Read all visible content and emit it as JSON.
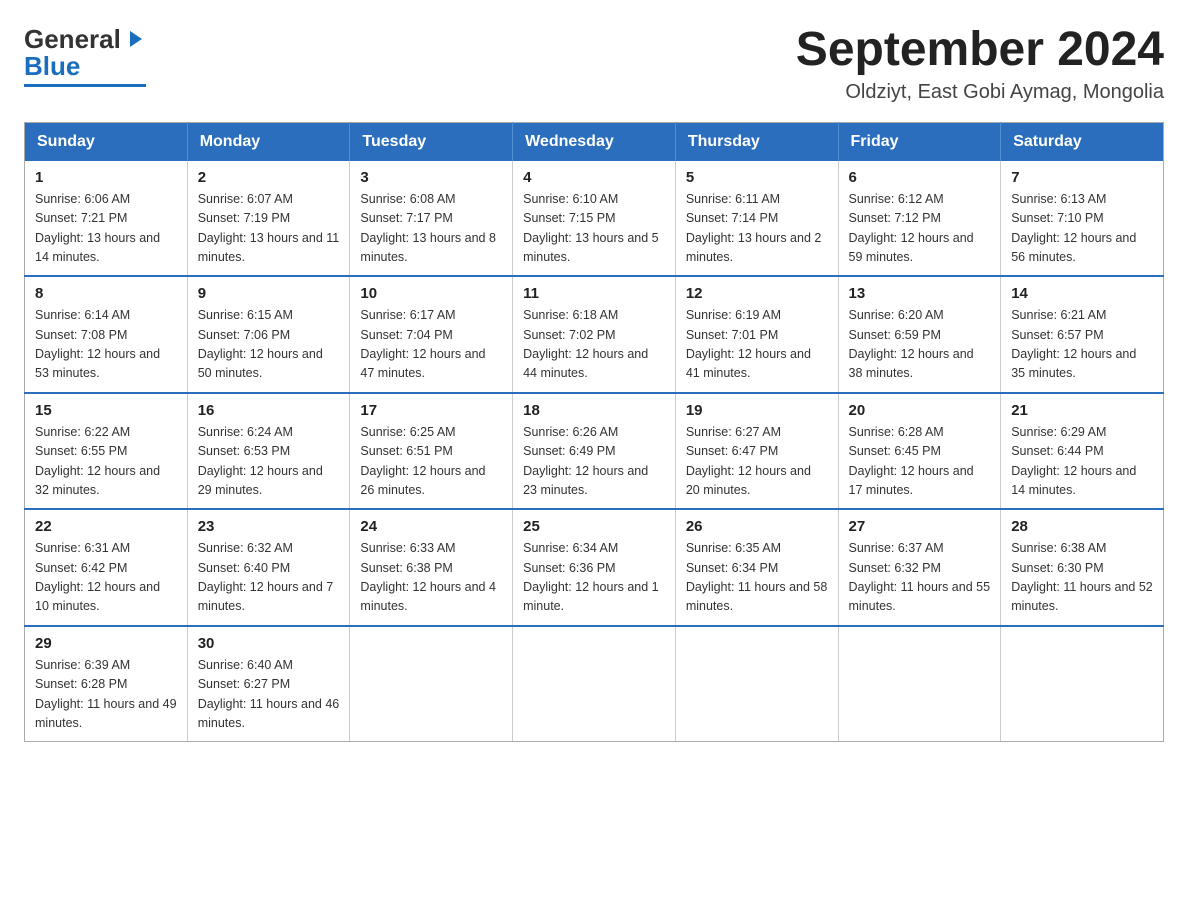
{
  "header": {
    "logo_general": "General",
    "logo_blue": "Blue",
    "main_title": "September 2024",
    "subtitle": "Oldziyt, East Gobi Aymag, Mongolia"
  },
  "calendar": {
    "days": [
      "Sunday",
      "Monday",
      "Tuesday",
      "Wednesday",
      "Thursday",
      "Friday",
      "Saturday"
    ],
    "weeks": [
      [
        {
          "num": "1",
          "sunrise": "Sunrise: 6:06 AM",
          "sunset": "Sunset: 7:21 PM",
          "daylight": "Daylight: 13 hours and 14 minutes."
        },
        {
          "num": "2",
          "sunrise": "Sunrise: 6:07 AM",
          "sunset": "Sunset: 7:19 PM",
          "daylight": "Daylight: 13 hours and 11 minutes."
        },
        {
          "num": "3",
          "sunrise": "Sunrise: 6:08 AM",
          "sunset": "Sunset: 7:17 PM",
          "daylight": "Daylight: 13 hours and 8 minutes."
        },
        {
          "num": "4",
          "sunrise": "Sunrise: 6:10 AM",
          "sunset": "Sunset: 7:15 PM",
          "daylight": "Daylight: 13 hours and 5 minutes."
        },
        {
          "num": "5",
          "sunrise": "Sunrise: 6:11 AM",
          "sunset": "Sunset: 7:14 PM",
          "daylight": "Daylight: 13 hours and 2 minutes."
        },
        {
          "num": "6",
          "sunrise": "Sunrise: 6:12 AM",
          "sunset": "Sunset: 7:12 PM",
          "daylight": "Daylight: 12 hours and 59 minutes."
        },
        {
          "num": "7",
          "sunrise": "Sunrise: 6:13 AM",
          "sunset": "Sunset: 7:10 PM",
          "daylight": "Daylight: 12 hours and 56 minutes."
        }
      ],
      [
        {
          "num": "8",
          "sunrise": "Sunrise: 6:14 AM",
          "sunset": "Sunset: 7:08 PM",
          "daylight": "Daylight: 12 hours and 53 minutes."
        },
        {
          "num": "9",
          "sunrise": "Sunrise: 6:15 AM",
          "sunset": "Sunset: 7:06 PM",
          "daylight": "Daylight: 12 hours and 50 minutes."
        },
        {
          "num": "10",
          "sunrise": "Sunrise: 6:17 AM",
          "sunset": "Sunset: 7:04 PM",
          "daylight": "Daylight: 12 hours and 47 minutes."
        },
        {
          "num": "11",
          "sunrise": "Sunrise: 6:18 AM",
          "sunset": "Sunset: 7:02 PM",
          "daylight": "Daylight: 12 hours and 44 minutes."
        },
        {
          "num": "12",
          "sunrise": "Sunrise: 6:19 AM",
          "sunset": "Sunset: 7:01 PM",
          "daylight": "Daylight: 12 hours and 41 minutes."
        },
        {
          "num": "13",
          "sunrise": "Sunrise: 6:20 AM",
          "sunset": "Sunset: 6:59 PM",
          "daylight": "Daylight: 12 hours and 38 minutes."
        },
        {
          "num": "14",
          "sunrise": "Sunrise: 6:21 AM",
          "sunset": "Sunset: 6:57 PM",
          "daylight": "Daylight: 12 hours and 35 minutes."
        }
      ],
      [
        {
          "num": "15",
          "sunrise": "Sunrise: 6:22 AM",
          "sunset": "Sunset: 6:55 PM",
          "daylight": "Daylight: 12 hours and 32 minutes."
        },
        {
          "num": "16",
          "sunrise": "Sunrise: 6:24 AM",
          "sunset": "Sunset: 6:53 PM",
          "daylight": "Daylight: 12 hours and 29 minutes."
        },
        {
          "num": "17",
          "sunrise": "Sunrise: 6:25 AM",
          "sunset": "Sunset: 6:51 PM",
          "daylight": "Daylight: 12 hours and 26 minutes."
        },
        {
          "num": "18",
          "sunrise": "Sunrise: 6:26 AM",
          "sunset": "Sunset: 6:49 PM",
          "daylight": "Daylight: 12 hours and 23 minutes."
        },
        {
          "num": "19",
          "sunrise": "Sunrise: 6:27 AM",
          "sunset": "Sunset: 6:47 PM",
          "daylight": "Daylight: 12 hours and 20 minutes."
        },
        {
          "num": "20",
          "sunrise": "Sunrise: 6:28 AM",
          "sunset": "Sunset: 6:45 PM",
          "daylight": "Daylight: 12 hours and 17 minutes."
        },
        {
          "num": "21",
          "sunrise": "Sunrise: 6:29 AM",
          "sunset": "Sunset: 6:44 PM",
          "daylight": "Daylight: 12 hours and 14 minutes."
        }
      ],
      [
        {
          "num": "22",
          "sunrise": "Sunrise: 6:31 AM",
          "sunset": "Sunset: 6:42 PM",
          "daylight": "Daylight: 12 hours and 10 minutes."
        },
        {
          "num": "23",
          "sunrise": "Sunrise: 6:32 AM",
          "sunset": "Sunset: 6:40 PM",
          "daylight": "Daylight: 12 hours and 7 minutes."
        },
        {
          "num": "24",
          "sunrise": "Sunrise: 6:33 AM",
          "sunset": "Sunset: 6:38 PM",
          "daylight": "Daylight: 12 hours and 4 minutes."
        },
        {
          "num": "25",
          "sunrise": "Sunrise: 6:34 AM",
          "sunset": "Sunset: 6:36 PM",
          "daylight": "Daylight: 12 hours and 1 minute."
        },
        {
          "num": "26",
          "sunrise": "Sunrise: 6:35 AM",
          "sunset": "Sunset: 6:34 PM",
          "daylight": "Daylight: 11 hours and 58 minutes."
        },
        {
          "num": "27",
          "sunrise": "Sunrise: 6:37 AM",
          "sunset": "Sunset: 6:32 PM",
          "daylight": "Daylight: 11 hours and 55 minutes."
        },
        {
          "num": "28",
          "sunrise": "Sunrise: 6:38 AM",
          "sunset": "Sunset: 6:30 PM",
          "daylight": "Daylight: 11 hours and 52 minutes."
        }
      ],
      [
        {
          "num": "29",
          "sunrise": "Sunrise: 6:39 AM",
          "sunset": "Sunset: 6:28 PM",
          "daylight": "Daylight: 11 hours and 49 minutes."
        },
        {
          "num": "30",
          "sunrise": "Sunrise: 6:40 AM",
          "sunset": "Sunset: 6:27 PM",
          "daylight": "Daylight: 11 hours and 46 minutes."
        },
        null,
        null,
        null,
        null,
        null
      ]
    ]
  }
}
